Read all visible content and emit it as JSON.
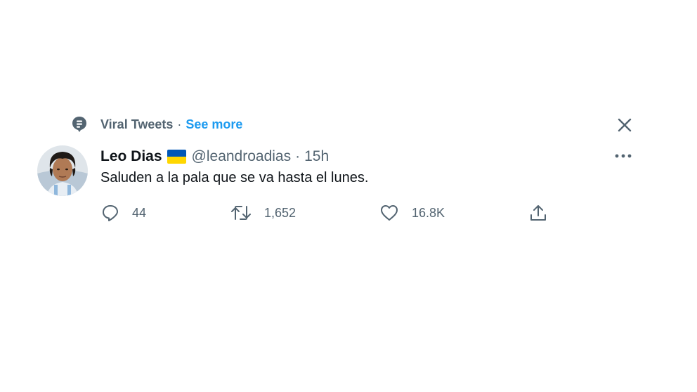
{
  "context": {
    "label": "Viral Tweets",
    "separator": "·",
    "see_more": "See more"
  },
  "tweet": {
    "name": "Leo Dias",
    "handle": "@leandroadias",
    "separator": "·",
    "time": "15h",
    "text": "Saluden a la pala que se va hasta el lunes."
  },
  "actions": {
    "replies": "44",
    "retweets": "1,652",
    "likes": "16.8K"
  },
  "icons": {
    "context": "topic-icon",
    "close": "close-icon",
    "more": "more-icon",
    "reply": "reply-icon",
    "retweet": "retweet-icon",
    "like": "heart-icon",
    "share": "share-icon"
  },
  "colors": {
    "text_primary": "#0f1419",
    "text_secondary": "#536471",
    "link": "#1d9bf0",
    "flag_blue": "#0057b7",
    "flag_yellow": "#ffd700"
  }
}
